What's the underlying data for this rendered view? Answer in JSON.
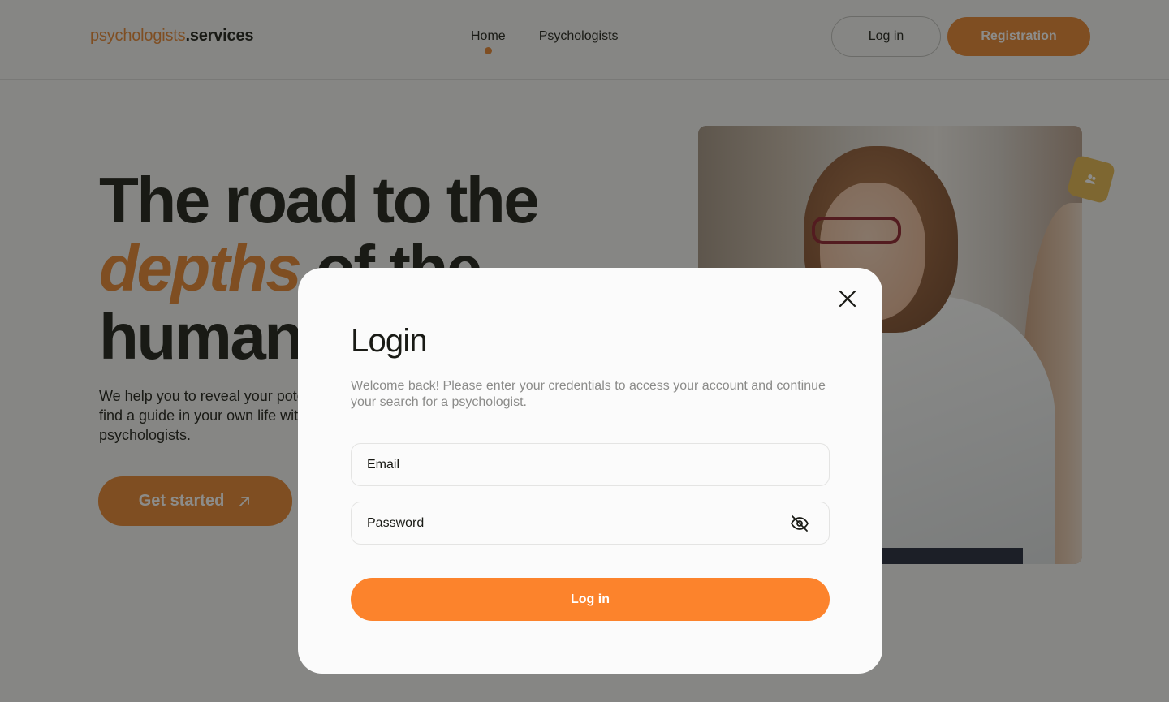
{
  "header": {
    "logo_part1": "psychologists",
    "logo_part2": ".services",
    "nav": [
      {
        "label": "Home",
        "active": true
      },
      {
        "label": "Psychologists",
        "active": false
      }
    ],
    "login_label": "Log in",
    "register_label": "Registration"
  },
  "hero": {
    "title_line1": "The road to the",
    "title_accent": "depths",
    "title_line2_rest": " of the",
    "title_line3": "human soul",
    "description": "We help you to reveal your potential, overcome challenges and find a guide in your own life with the help of our experienced psychologists.",
    "cta_label": "Get started"
  },
  "modal": {
    "title": "Login",
    "description": "Welcome back! Please enter your credentials to access your account and continue your search for a psychologist.",
    "email_placeholder": "Email",
    "password_placeholder": "Password",
    "submit_label": "Log in"
  },
  "colors": {
    "accent": "#e4822e",
    "submit": "#fc832c",
    "text": "#191a15"
  },
  "icons": {
    "close": "close-icon",
    "password_toggle": "eye-off-icon",
    "cta_arrow": "arrow-up-right-icon",
    "badge": "users-icon"
  }
}
